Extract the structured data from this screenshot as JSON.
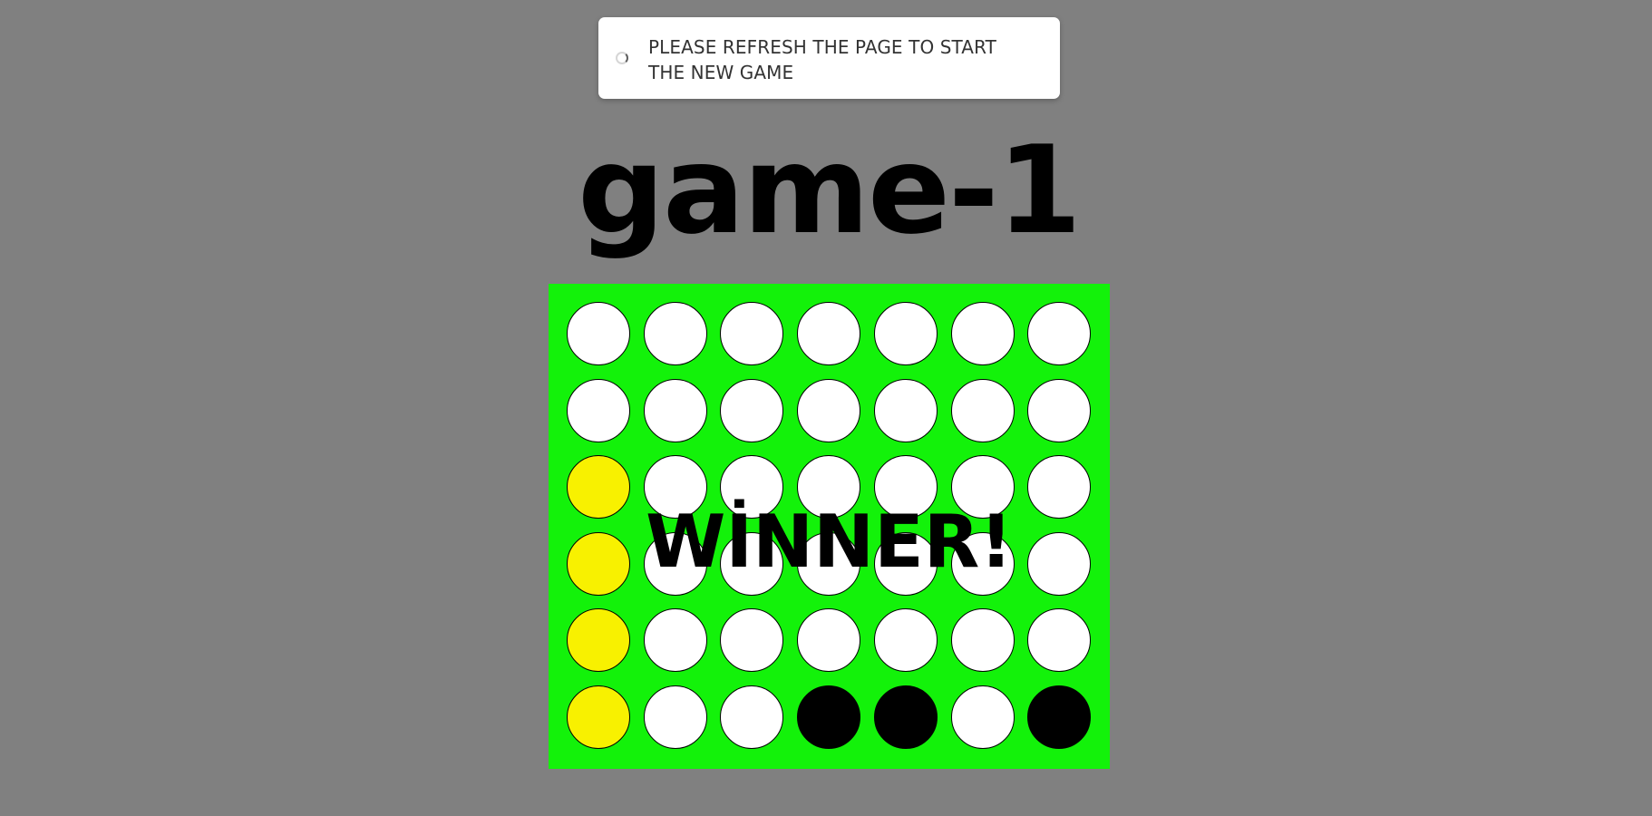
{
  "notification": {
    "message": "PLEASE REFRESH THE PAGE TO START THE NEW GAME",
    "icon": "loading-spinner-icon"
  },
  "game": {
    "title": "game-1",
    "status_text": "WİNNER!",
    "colors": {
      "background": "#808080",
      "board": "#13f20a",
      "empty": "#ffffff",
      "player_yellow": "#f8f100",
      "player_black": "#000000"
    },
    "board": [
      [
        "empty",
        "empty",
        "empty",
        "empty",
        "empty",
        "empty",
        "empty"
      ],
      [
        "empty",
        "empty",
        "empty",
        "empty",
        "empty",
        "empty",
        "empty"
      ],
      [
        "yellow",
        "empty",
        "empty",
        "empty",
        "empty",
        "empty",
        "empty"
      ],
      [
        "yellow",
        "empty",
        "empty",
        "empty",
        "empty",
        "empty",
        "empty"
      ],
      [
        "yellow",
        "empty",
        "empty",
        "empty",
        "empty",
        "empty",
        "empty"
      ],
      [
        "yellow",
        "empty",
        "empty",
        "black",
        "black",
        "empty",
        "black"
      ]
    ]
  }
}
